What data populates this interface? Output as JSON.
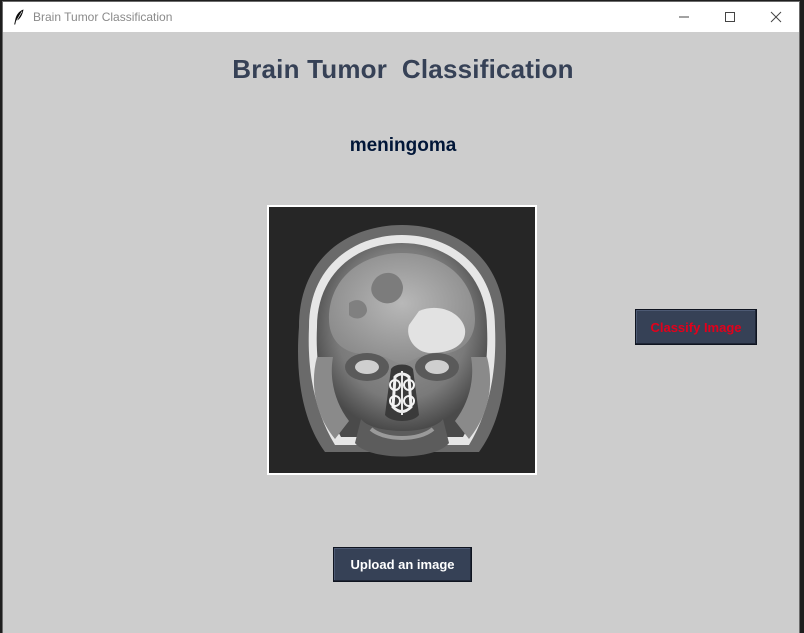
{
  "window": {
    "title": "Brain Tumor Classification",
    "icon": "feather-icon",
    "controls": [
      "minimize-icon",
      "maximize-icon",
      "close-icon"
    ]
  },
  "app": {
    "heading": "Brain Tumor  Classification",
    "prediction": "meningoma",
    "image_alt": "brain MRI scan",
    "classify_label": "Classify Image",
    "upload_label": "Upload an image"
  },
  "colors": {
    "background": "#cdcdcd",
    "heading": "#364156",
    "prediction": "#011638",
    "button_bg": "#364156",
    "classify_text": "#e3001b",
    "upload_text": "#ffffff"
  }
}
